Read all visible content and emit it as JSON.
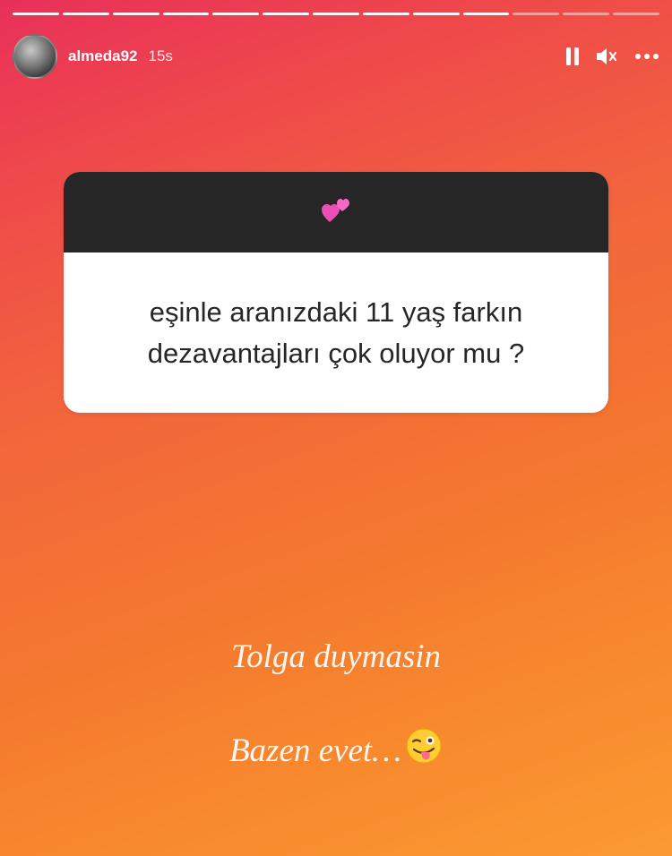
{
  "story": {
    "total_segments": 13,
    "completed_segments": 10
  },
  "header": {
    "username": "almeda92",
    "time_ago": "15s",
    "icons": [
      "pause-icon",
      "mute-icon",
      "more-icon"
    ]
  },
  "question_card": {
    "icon": "two-hearts-emoji",
    "text": "eşinle aranızdaki 11 yaş farkın dezavantajları çok oluyor mu ?"
  },
  "answers": {
    "line1": "Tolga duymasin",
    "line2": "Bazen evet…",
    "line2_icon": "winking-face-with-tongue-emoji"
  },
  "colors": {
    "gradient_top": "#e8305a",
    "gradient_bottom": "#fb9a33",
    "card_header": "#262626",
    "card_body": "#ffffff"
  }
}
